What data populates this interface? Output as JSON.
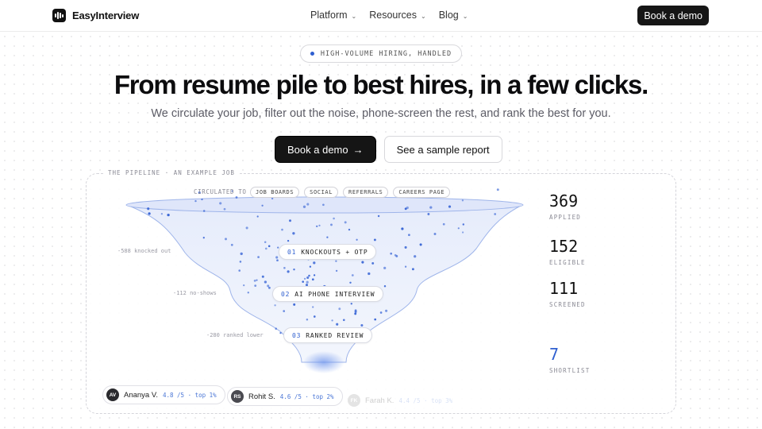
{
  "header": {
    "brand": "EasyInterview",
    "nav": [
      "Platform",
      "Resources",
      "Blog"
    ],
    "cta": "Book a demo"
  },
  "hero": {
    "eyebrow": "HIGH-VOLUME HIRING, HANDLED",
    "title": "From resume pile to best hires, in a few clicks.",
    "subtitle": "We circulate your job, filter out the noise, phone-screen the rest, and rank the best for you.",
    "primary_cta": "Book a demo",
    "primary_arrow": "→",
    "secondary_cta": "See a sample report"
  },
  "pipeline": {
    "label": "THE PIPELINE · AN EXAMPLE JOB",
    "circulated_label": "CIRCULATED TO",
    "channels": [
      "JOB BOARDS",
      "SOCIAL",
      "REFERRALS",
      "CAREERS PAGE"
    ],
    "stages": [
      {
        "num": "01",
        "name": "KNOCKOUTS + OTP"
      },
      {
        "num": "02",
        "name": "AI PHONE INTERVIEW"
      },
      {
        "num": "03",
        "name": "RANKED REVIEW"
      }
    ],
    "drop_notes": [
      "-588 knocked out",
      "-112 no-shows",
      "-280 ranked lower"
    ],
    "metrics": [
      {
        "value": "369",
        "label": "APPLIED"
      },
      {
        "value": "152",
        "label": "ELIGIBLE"
      },
      {
        "value": "111",
        "label": "SCREENED"
      },
      {
        "value": "7",
        "label": "SHORTLIST"
      }
    ],
    "candidates": [
      {
        "initials": "AV",
        "name": "Ananya V.",
        "score": "4.8 /5 · top 1%"
      },
      {
        "initials": "RS",
        "name": "Rohit S.",
        "score": "4.6 /5 · top 2%"
      },
      {
        "initials": "FK",
        "name": "Farah K.",
        "score": "4.4 /5 · top 3%"
      }
    ]
  },
  "colors": {
    "accent": "#2f5fd0",
    "dark": "#151515",
    "funnel_fill": "#e9eefc"
  }
}
